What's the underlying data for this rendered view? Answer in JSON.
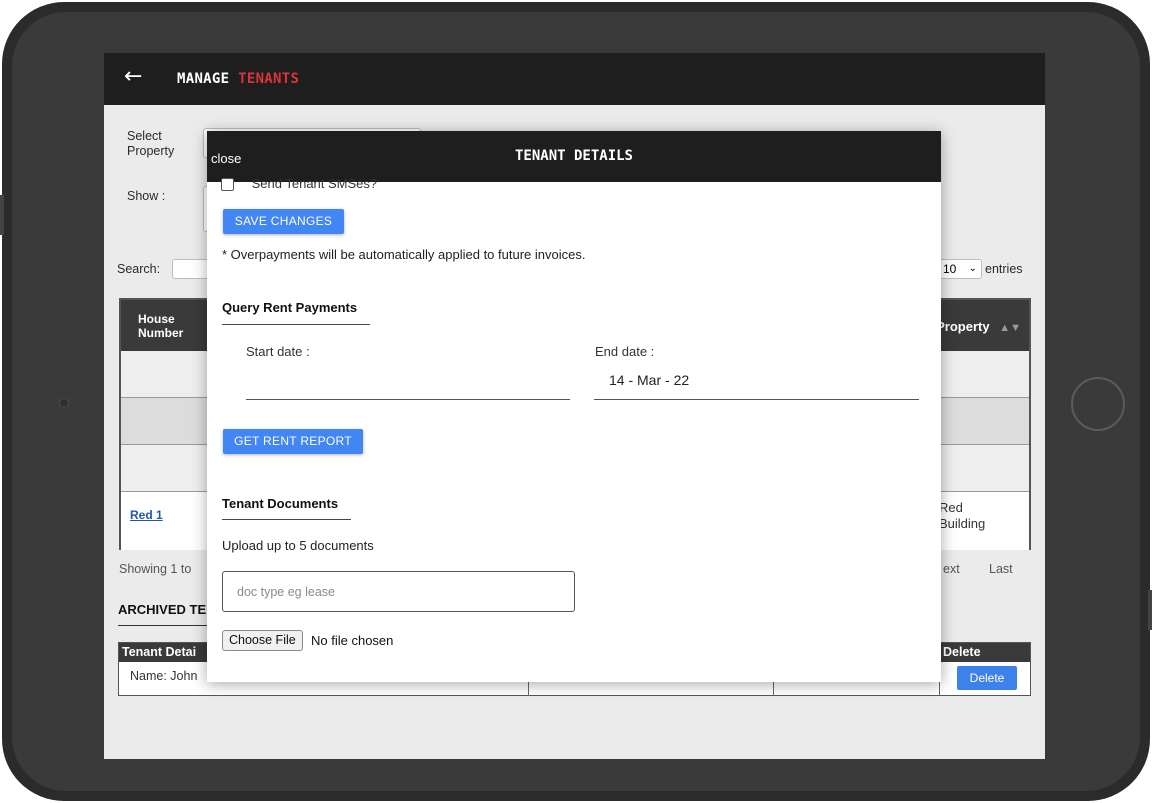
{
  "app": {
    "title_prefix": "MANAGE",
    "title_accent": "TENANTS",
    "accent_color": "#d9343a"
  },
  "background": {
    "select_property_label": "Select Property",
    "show_label": "Show :",
    "search_label": "Search:",
    "entries_value": "10",
    "entries_label": "entries",
    "table": {
      "col_house_number": "House Number",
      "col_property": "Property",
      "rows": [
        {
          "house": "",
          "property": ""
        },
        {
          "house": "",
          "property": ""
        },
        {
          "house": "",
          "property": ""
        },
        {
          "house": "Red 1",
          "property": "Red Building"
        }
      ]
    },
    "pager": {
      "showing_text": "Showing 1 to",
      "next_label": "ext",
      "last_label": "Last"
    },
    "archived": {
      "title": "ARCHIVED TE",
      "col_tenant_details": "Tenant Detai",
      "col_delete": "Delete",
      "row_tenant": "Name: John",
      "delete_button": "Delete"
    }
  },
  "modal": {
    "close_label": "close",
    "title": "TENANT DETAILS",
    "send_sms_label": "Send Tenant SMSes?",
    "save_button": "SAVE CHANGES",
    "overpayment_note": "* Overpayments will be automatically applied to future invoices.",
    "query_section_title": "Query Rent Payments",
    "start_date_label": "Start date :",
    "start_date_value": "",
    "end_date_label": "End date :",
    "end_date_value": "14 - Mar - 22",
    "report_button": "GET RENT REPORT",
    "documents_section_title": "Tenant Documents",
    "upload_hint": "Upload up to 5 documents",
    "doc_type_placeholder": "doc type eg lease",
    "choose_file_button": "Choose File",
    "file_status": "No file chosen",
    "button_color": "#4285f4"
  }
}
